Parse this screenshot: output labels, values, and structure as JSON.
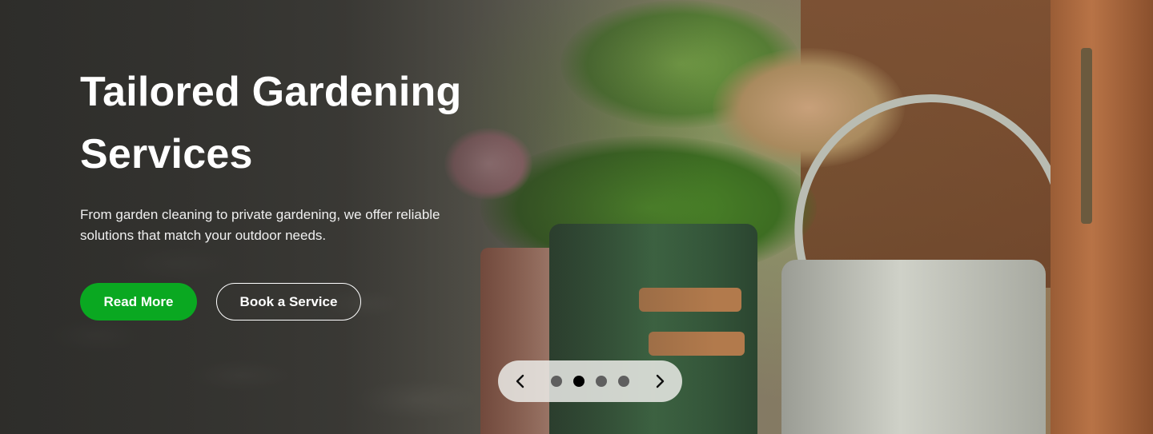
{
  "hero": {
    "title_line1": "Tailored Gardening",
    "title_line2": "Services",
    "description": "From garden cleaning to private gardening, we offer reliable solutions that match your outdoor needs.",
    "buttons": {
      "read_more": "Read More",
      "book_service": "Book a Service"
    }
  },
  "carousel": {
    "slide_count": 4,
    "active_index": 1,
    "prev_icon": "chevron-left-icon",
    "next_icon": "chevron-right-icon"
  },
  "colors": {
    "primary_button": "#0aa821",
    "active_dot": "#000000",
    "inactive_dot": "#5f5f5f"
  }
}
